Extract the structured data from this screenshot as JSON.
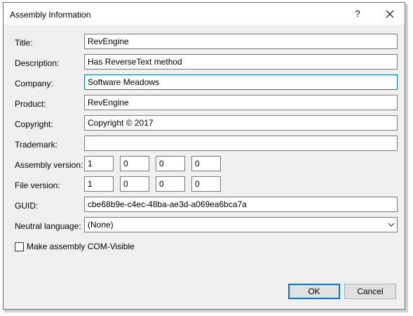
{
  "window": {
    "title": "Assembly Information",
    "help_label": "?"
  },
  "fields": {
    "title": {
      "label": "Title:",
      "value": "RevEngine"
    },
    "description": {
      "label": "Description:",
      "value": "Has ReverseText method"
    },
    "company": {
      "label": "Company:",
      "value": "Software Meadows"
    },
    "product": {
      "label": "Product:",
      "value": "RevEngine"
    },
    "copyright": {
      "label": "Copyright:",
      "value": "Copyright ©  2017"
    },
    "trademark": {
      "label": "Trademark:",
      "value": ""
    },
    "assembly_version": {
      "label": "Assembly version:",
      "parts": [
        "1",
        "0",
        "0",
        "0"
      ]
    },
    "file_version": {
      "label": "File version:",
      "parts": [
        "1",
        "0",
        "0",
        "0"
      ]
    },
    "guid": {
      "label": "GUID:",
      "value": "cbe68b9e-c4ec-48ba-ae3d-a069ea6bca7a"
    },
    "neutral_language": {
      "label": "Neutral language:",
      "value": "(None)"
    }
  },
  "com_visible": {
    "label": "Make assembly COM-Visible",
    "checked": false
  },
  "buttons": {
    "ok": "OK",
    "cancel": "Cancel"
  },
  "colors": {
    "focus_border": "#0078d7",
    "dialog_bg": "#f0f0f0"
  },
  "icons": {
    "close": "close-icon",
    "dropdown": "chevron-down-icon"
  }
}
